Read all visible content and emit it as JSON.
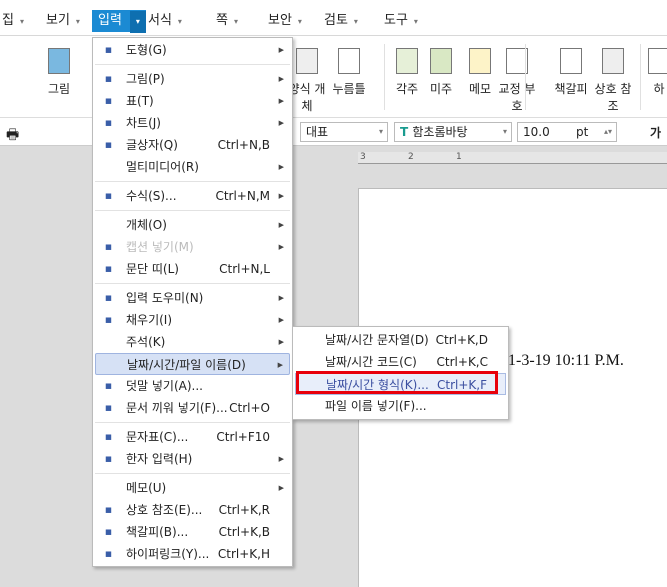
{
  "menubar": {
    "items": [
      {
        "label": "집"
      },
      {
        "label": "보기"
      },
      {
        "label": "입력",
        "active": true
      },
      {
        "label": "서식"
      },
      {
        "label": "쪽"
      },
      {
        "label": "보안"
      },
      {
        "label": "검토"
      },
      {
        "label": "도구"
      }
    ],
    "arrow": "▾"
  },
  "toolbar": {
    "buttons": [
      {
        "label": "그림"
      },
      {
        "label": "양식 개체"
      },
      {
        "label": "누름틀"
      },
      {
        "label": "각주"
      },
      {
        "label": "미주"
      },
      {
        "label": "메모"
      },
      {
        "label": "교정 부호"
      },
      {
        "label": "책갈피"
      },
      {
        "label": "상호 참조"
      },
      {
        "label": "하"
      }
    ]
  },
  "format_bar": {
    "style": "대표",
    "font": "함초롬바탕",
    "size": "10.0",
    "unit": "pt",
    "bold_glyph": "가"
  },
  "ruler": {
    "labels": [
      "3",
      "2",
      "1"
    ]
  },
  "document": {
    "text": "1-3-19  10:11  P.M."
  },
  "menu": {
    "items": [
      {
        "label": "도형(G)",
        "icon": "shape-icon",
        "submenu": true
      },
      {
        "sep": true
      },
      {
        "label": "그림(P)",
        "icon": "picture-icon",
        "submenu": true
      },
      {
        "label": "표(T)",
        "icon": "table-icon",
        "submenu": true
      },
      {
        "label": "차트(J)",
        "icon": "chart-icon",
        "submenu": true
      },
      {
        "label": "글상자(Q)",
        "icon": "textbox-icon",
        "shortcut": "Ctrl+N,B"
      },
      {
        "label": "멀티미디어(R)",
        "submenu": true
      },
      {
        "sep": true
      },
      {
        "label": "수식(S)...",
        "icon": "formula-icon",
        "shortcut": "Ctrl+N,M",
        "submenu": true
      },
      {
        "sep": true
      },
      {
        "label": "개체(O)",
        "submenu": true
      },
      {
        "label": "캡션 넣기(M)",
        "icon": "caption-icon",
        "submenu": true,
        "disabled": true
      },
      {
        "label": "문단 띠(L)",
        "icon": "paragraph-band-icon",
        "shortcut": "Ctrl+N,L"
      },
      {
        "sep": true
      },
      {
        "label": "입력 도우미(N)",
        "icon": "input-helper-icon",
        "submenu": true
      },
      {
        "label": "채우기(I)",
        "icon": "fill-icon",
        "submenu": true
      },
      {
        "label": "주석(K)",
        "submenu": true
      },
      {
        "label": "날짜/시간/파일 이름(D)",
        "submenu": true,
        "highlighted": true
      },
      {
        "label": "덧말 넣기(A)...",
        "icon": "ruby-text-icon"
      },
      {
        "label": "문서 끼워 넣기(F)...",
        "icon": "insert-document-icon",
        "shortcut": "Ctrl+O"
      },
      {
        "sep": true
      },
      {
        "label": "문자표(C)...",
        "icon": "symbol-icon",
        "shortcut": "Ctrl+F10"
      },
      {
        "label": "한자 입력(H)",
        "icon": "hanja-icon",
        "submenu": true
      },
      {
        "sep": true
      },
      {
        "label": "메모(U)",
        "submenu": true
      },
      {
        "label": "상호 참조(E)...",
        "icon": "cross-reference-icon",
        "shortcut": "Ctrl+K,R"
      },
      {
        "label": "책갈피(B)...",
        "icon": "bookmark-icon",
        "shortcut": "Ctrl+K,B"
      },
      {
        "label": "하이퍼링크(Y)...",
        "icon": "hyperlink-icon",
        "shortcut": "Ctrl+K,H"
      }
    ]
  },
  "submenu": {
    "items": [
      {
        "label": "날짜/시간 문자열(D)",
        "shortcut": "Ctrl+K,D"
      },
      {
        "label": "날짜/시간 코드(C)",
        "shortcut": "Ctrl+K,C"
      },
      {
        "label": "날짜/시간 형식(K)...",
        "shortcut": "Ctrl+K,F",
        "selected": true
      },
      {
        "label": "파일 이름 넣기(F)..."
      }
    ]
  },
  "colors": {
    "accent": "#1b8ad3",
    "highlight": "#d6e1f5",
    "annotation": "#e8000b"
  }
}
